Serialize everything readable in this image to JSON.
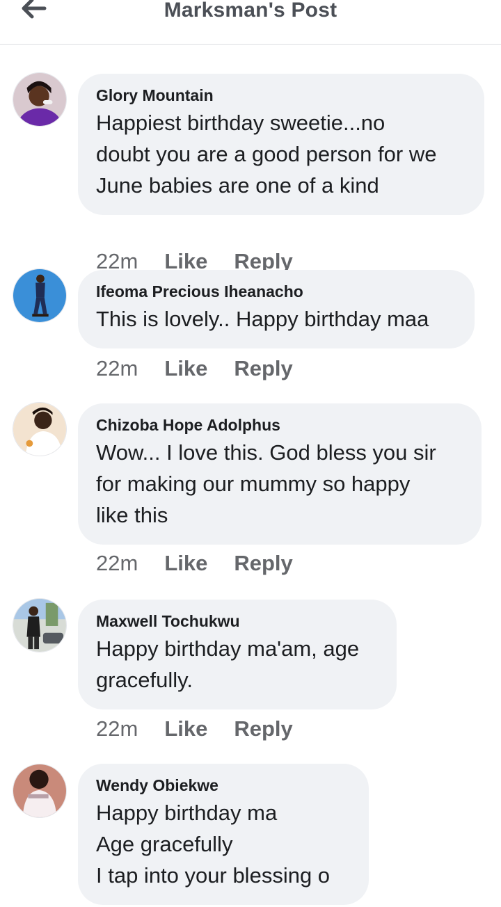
{
  "header": {
    "title": "Marksman's Post"
  },
  "comments": [
    {
      "author": "Glory Mountain",
      "lines": [
        "Happiest birthday sweetie...no",
        "doubt you are a good person for we",
        "June babies are one of a kind"
      ],
      "time": "22m",
      "like": "Like",
      "reply": "Reply"
    },
    {
      "author": "Ifeoma Precious Iheanacho",
      "lines": [
        "This is lovely.. Happy birthday maa"
      ],
      "time": "22m",
      "like": "Like",
      "reply": "Reply"
    },
    {
      "author": "Chizoba Hope Adolphus",
      "lines": [
        "Wow... I love this. God bless you sir",
        "for making our mummy so happy",
        "like this"
      ],
      "time": "22m",
      "like": "Like",
      "reply": "Reply"
    },
    {
      "author": "Maxwell Tochukwu",
      "lines": [
        "Happy birthday ma'am, age",
        "gracefully."
      ],
      "time": "22m",
      "like": "Like",
      "reply": "Reply"
    },
    {
      "author": "Wendy Obiekwe",
      "lines": [
        "Happy birthday ma",
        "Age gracefully",
        "I tap into your blessing o"
      ]
    }
  ],
  "colors": {
    "bubble": "#f0f2f5",
    "meta_text": "#65676b",
    "header_text": "#4b4f56"
  },
  "icons": {
    "back": "arrow-left-icon"
  }
}
